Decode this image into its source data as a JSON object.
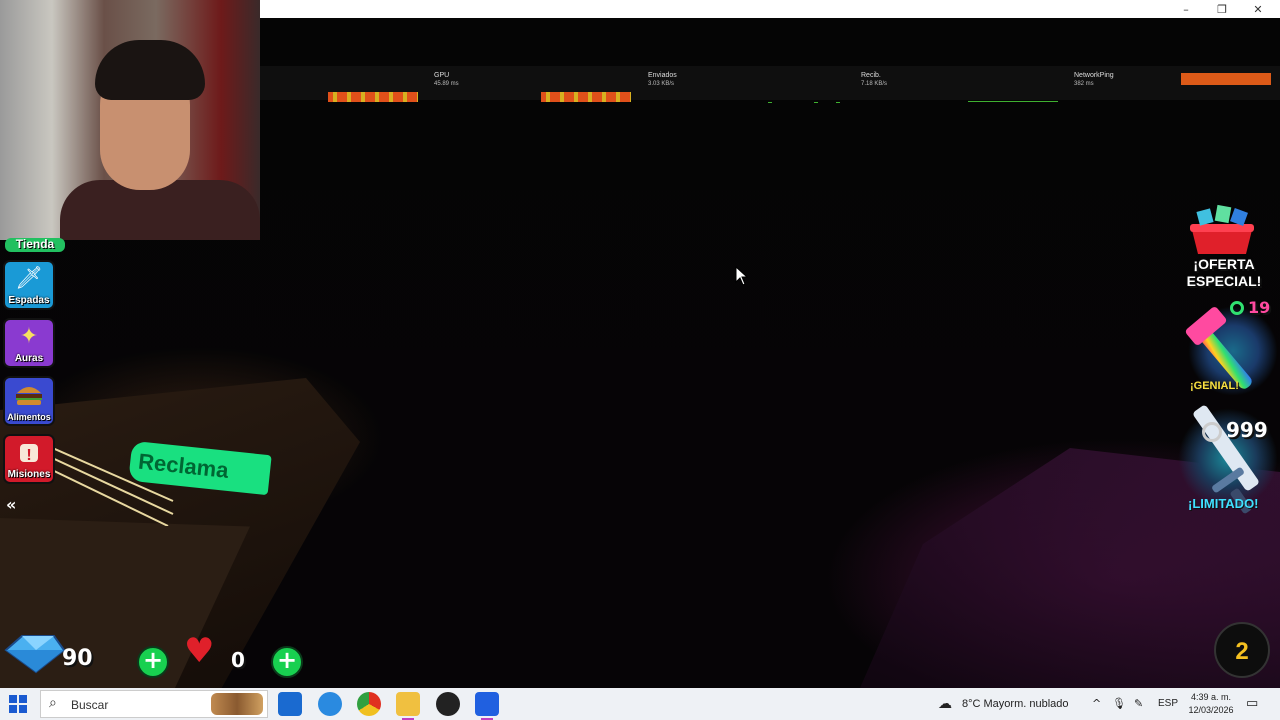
{
  "window": {
    "minimize_icon": "–",
    "restore_icon": "❐",
    "close_icon": "✕"
  },
  "stats_bar": {
    "gpu": {
      "label": "GPU",
      "value": "45.89 ms"
    },
    "sent": {
      "label": "Enviados",
      "value": "3.03 KB/s"
    },
    "received": {
      "label": "Recib.",
      "value": "7.18 KB/s"
    },
    "ping": {
      "label": "NetworkPing",
      "value": "382 ms"
    }
  },
  "sidebar": {
    "tienda": "Tienda",
    "items": [
      {
        "label": "Espadas",
        "icon": "sword-icon",
        "color": "#1a9ad6"
      },
      {
        "label": "Auras",
        "icon": "sparkle-icon",
        "color": "#8a3ad0"
      },
      {
        "label": "Alimentos",
        "icon": "burger-icon",
        "color": "#3a4ad0"
      },
      {
        "label": "Misiones",
        "icon": "scroll-icon",
        "color": "#d21a2a"
      }
    ],
    "collapse_icon": "«"
  },
  "world": {
    "claim_sign": "Reclama"
  },
  "offers": {
    "special": "¡OFERTA ESPECIAL!",
    "deal1": {
      "count": "19",
      "tag": "¡GENIAL!"
    },
    "deal2": {
      "count": "999",
      "tag": "¡LIMITADO!"
    }
  },
  "currency": {
    "gems": "90",
    "plus": "+",
    "lives": "0",
    "plus2": "+"
  },
  "round_badge": "2",
  "taskbar": {
    "search_placeholder": "Buscar",
    "weather": "8°C  Mayorm. nublado",
    "lang": "ESP",
    "time": "4:39 a. m.",
    "date": "12/03/2026"
  },
  "colors": {
    "accent_green": "#19e080",
    "gpu_bar": "#e0501a",
    "ping_bar": "#dc5a18",
    "taskbar": "#eef1f5"
  }
}
